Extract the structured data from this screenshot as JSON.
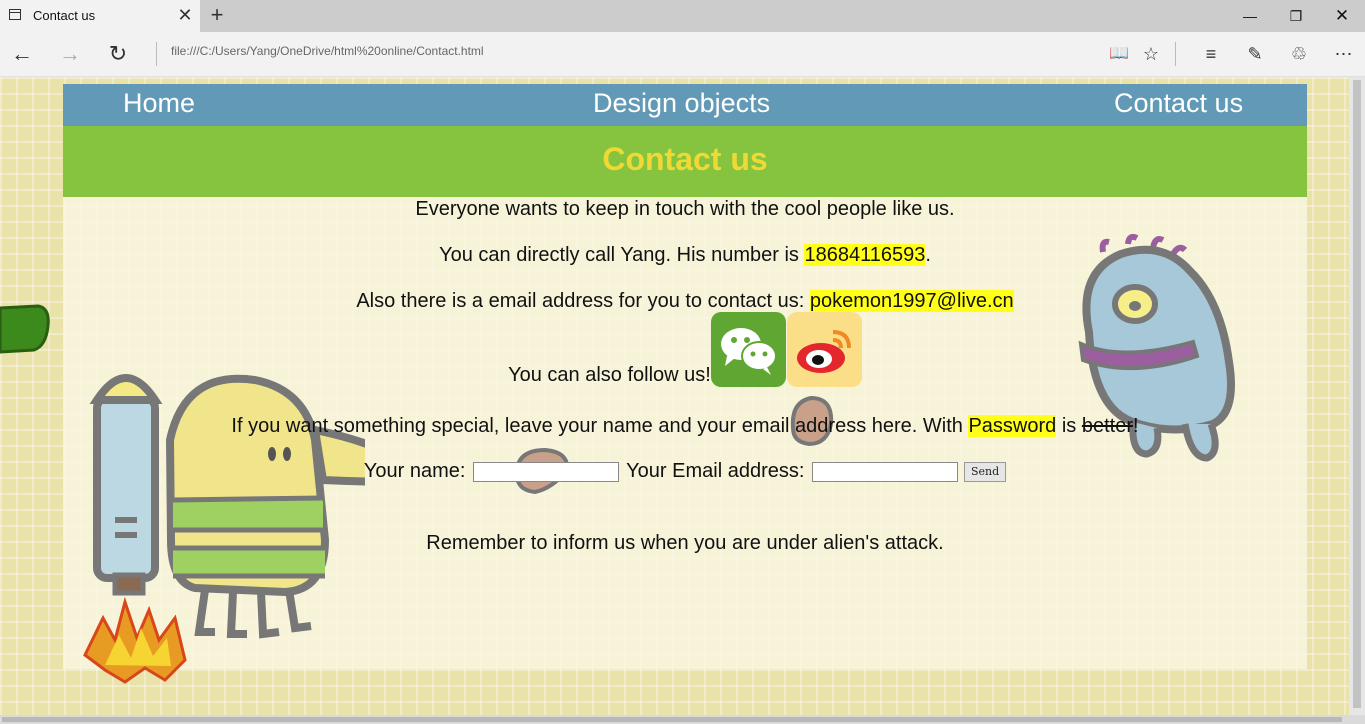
{
  "browser": {
    "tab_title": "Contact us",
    "url": "file:///C:/Users/Yang/OneDrive/html%20online/Contact.html"
  },
  "nav": {
    "home": "Home",
    "design": "Design objects",
    "contact": "Contact us"
  },
  "banner": {
    "title": "Contact us"
  },
  "content": {
    "intro": "Everyone wants to keep in touch with the cool people like us.",
    "call_prefix": "You can directly call Yang. His number is ",
    "phone": "18684116593",
    "call_suffix": ".",
    "email_prefix": "Also there is a email address for you to contact us: ",
    "email": "pokemon1997@live.cn",
    "follow": "You can also follow us!",
    "special_prefix": "If you want something special, leave your name and your email address here. With ",
    "password_word": "Password",
    "special_mid": " is ",
    "better_word": "better",
    "special_suffix": "!",
    "name_label": "Your name: ",
    "email_label": " Your Email address: ",
    "send": "Send",
    "remember": "Remember to inform us when you are under alien's attack."
  },
  "colors": {
    "nav_bg": "#6199b6",
    "banner_bg": "#86c440",
    "banner_text": "#f1d935",
    "highlight": "#ffff1a",
    "wechat": "#5fa732",
    "weibo": "#fbdf88"
  },
  "icons": [
    "wechat-icon",
    "weibo-icon",
    "doodle-jumper-illustration",
    "alien-monster-illustration"
  ]
}
